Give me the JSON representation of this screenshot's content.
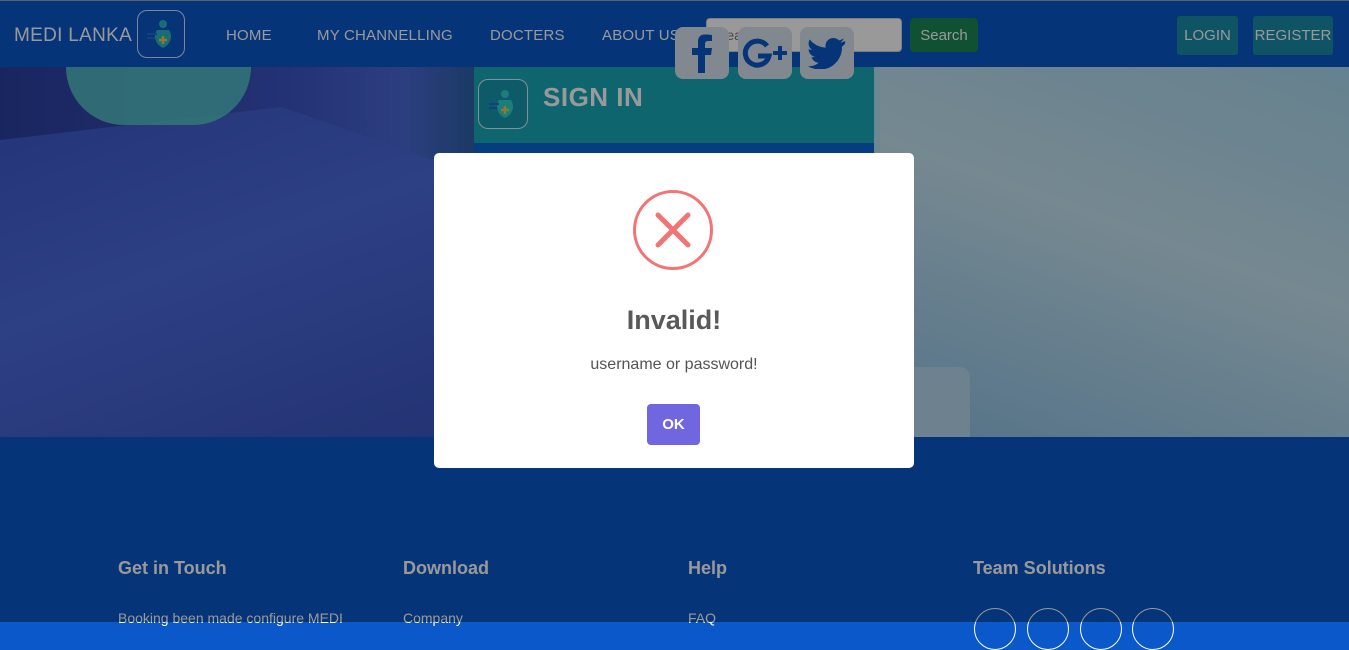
{
  "navbar": {
    "brand": "MEDI LANKA",
    "links": [
      "HOME",
      "MY CHANNELLING",
      "DOCTERS",
      "ABOUT US"
    ],
    "search_placeholder": "Search...",
    "search_button": "Search",
    "login": "LOGIN",
    "register": "REGISTER"
  },
  "social": [
    "facebook-icon",
    "google-plus-icon",
    "twitter-icon"
  ],
  "signin": {
    "title": "SIGN IN"
  },
  "footer": {
    "columns": [
      {
        "title": "Get in Touch",
        "text": "Booking been made configure MEDI"
      },
      {
        "title": "Download",
        "text": "Company"
      },
      {
        "title": "Help",
        "text": "FAQ"
      },
      {
        "title": "Team Solutions",
        "text": ""
      }
    ]
  },
  "modal": {
    "icon": "error-x-icon",
    "title": "Invalid!",
    "text": "username or password!",
    "ok_button": "OK",
    "icon_color": "#f27474",
    "button_color": "#7066e0"
  },
  "colors": {
    "primary": "#0a58ca",
    "teal": "#1aa8b8",
    "success": "#198754"
  }
}
